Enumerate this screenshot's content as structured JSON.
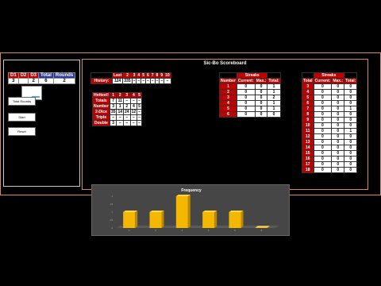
{
  "controls": {
    "dice_headers": [
      "D1",
      "D2",
      "D3"
    ],
    "total_header": "Total",
    "rounds_header": "Rounds",
    "dice_values": [
      "3",
      "",
      "2"
    ],
    "total_value": "6",
    "rounds_value": "2",
    "buttons": [
      "Total Rounds",
      "Start",
      "Reset"
    ]
  },
  "scoreboard": {
    "title": "Sic-Bo Scoreboard",
    "history": {
      "headers": [
        "Last",
        "2",
        "3",
        "4",
        "5",
        "6",
        "7",
        "8",
        "9",
        "10"
      ],
      "row_label": "History:",
      "values": [
        "124",
        "335",
        "–",
        "–",
        "–",
        "–",
        "–",
        "–",
        "–",
        "–"
      ]
    },
    "hottest": {
      "headers": [
        "Hottest!",
        "1",
        "2",
        "3",
        "4",
        "5"
      ],
      "rows": [
        {
          "label": "Totals",
          "values": [
            "7",
            "11",
            "–",
            "–",
            "–"
          ]
        },
        {
          "label": "Number",
          "values": [
            "3",
            "1",
            "2",
            "4",
            "5"
          ]
        },
        {
          "label": "2-Dice",
          "values": [
            "35",
            "14",
            "24",
            "12",
            "–"
          ]
        },
        {
          "label": "Triple",
          "values": [
            "–",
            "–",
            "–",
            "–",
            "–"
          ]
        },
        {
          "label": "Double",
          "values": [
            "3",
            "–",
            "–",
            "–",
            "–"
          ]
        }
      ]
    },
    "number_streaks": {
      "group_header": "Streaks",
      "headers": [
        "Number",
        "Current:",
        "Max.:",
        "Total:"
      ],
      "rows": [
        [
          "1",
          "0",
          "0",
          "1"
        ],
        [
          "2",
          "0",
          "0",
          "1"
        ],
        [
          "3",
          "0",
          "0",
          "2"
        ],
        [
          "4",
          "0",
          "0",
          "1"
        ],
        [
          "5",
          "0",
          "0",
          "1"
        ],
        [
          "6",
          "0",
          "0",
          "0"
        ]
      ]
    },
    "total_streaks": {
      "group_header": "Streaks",
      "headers": [
        "Total",
        "Current:",
        "Max.:",
        "Total:"
      ],
      "rows": [
        [
          "3",
          "0",
          "0",
          "0"
        ],
        [
          "4",
          "0",
          "0",
          "0"
        ],
        [
          "5",
          "0",
          "0",
          "0"
        ],
        [
          "6",
          "0",
          "0",
          "0"
        ],
        [
          "7",
          "0",
          "0",
          "1"
        ],
        [
          "8",
          "0",
          "0",
          "0"
        ],
        [
          "9",
          "0",
          "0",
          "0"
        ],
        [
          "10",
          "0",
          "0",
          "0"
        ],
        [
          "11",
          "0",
          "0",
          "1"
        ],
        [
          "12",
          "0",
          "0",
          "0"
        ],
        [
          "13",
          "0",
          "0",
          "0"
        ],
        [
          "14",
          "0",
          "0",
          "0"
        ],
        [
          "15",
          "0",
          "0",
          "0"
        ],
        [
          "16",
          "0",
          "0",
          "0"
        ],
        [
          "17",
          "0",
          "0",
          "0"
        ],
        [
          "18",
          "0",
          "0",
          "0"
        ]
      ]
    }
  },
  "chart_data": {
    "type": "bar",
    "title": "Frequency",
    "categories": [
      "1",
      "2",
      "3",
      "4",
      "5",
      "6"
    ],
    "values": [
      1,
      1,
      2,
      1,
      1,
      0
    ],
    "ylim": [
      0,
      2
    ],
    "ytick_labels": [
      "0",
      "0.5",
      "1",
      "1.5",
      "2"
    ],
    "bar_color": "#f5b800"
  }
}
